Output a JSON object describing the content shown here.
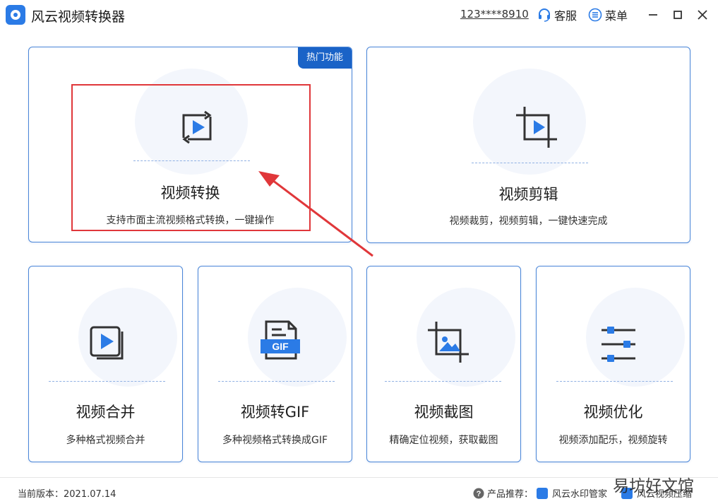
{
  "titlebar": {
    "app_title": "风云视频转换器",
    "account": "123****8910",
    "service_label": "客服",
    "menu_label": "菜单"
  },
  "cards": {
    "convert": {
      "title": "视频转换",
      "desc": "支持市面主流视频格式转换，一键操作",
      "badge": "热门功能"
    },
    "edit": {
      "title": "视频剪辑",
      "desc": "视频裁剪，视频剪辑，一键快速完成"
    },
    "merge": {
      "title": "视频合并",
      "desc": "多种格式视频合并"
    },
    "gif": {
      "title": "视频转GIF",
      "desc": "多种视频格式转换成GIF",
      "icon_text": "GIF"
    },
    "screenshot": {
      "title": "视频截图",
      "desc": "精确定位视频，获取截图"
    },
    "optimize": {
      "title": "视频优化",
      "desc": "视频添加配乐，视频旋转"
    }
  },
  "footer": {
    "version": "当前版本：2021.07.14",
    "recommend_label": "产品推荐：",
    "products": [
      "风云水印管家",
      "风云视频压缩"
    ]
  },
  "watermark": "易坊好文馆",
  "colors": {
    "accent": "#2b7be6",
    "badge": "#1a63c7",
    "highlight": "#e0373a",
    "border": "#4a86d8"
  },
  "icons": [
    "app-logo-icon",
    "headset-icon",
    "menu-icon",
    "minimize-icon",
    "maximize-icon",
    "close-icon",
    "convert-icon",
    "crop-icon",
    "merge-icon",
    "gif-file-icon",
    "screenshot-icon",
    "sliders-icon",
    "help-icon"
  ]
}
